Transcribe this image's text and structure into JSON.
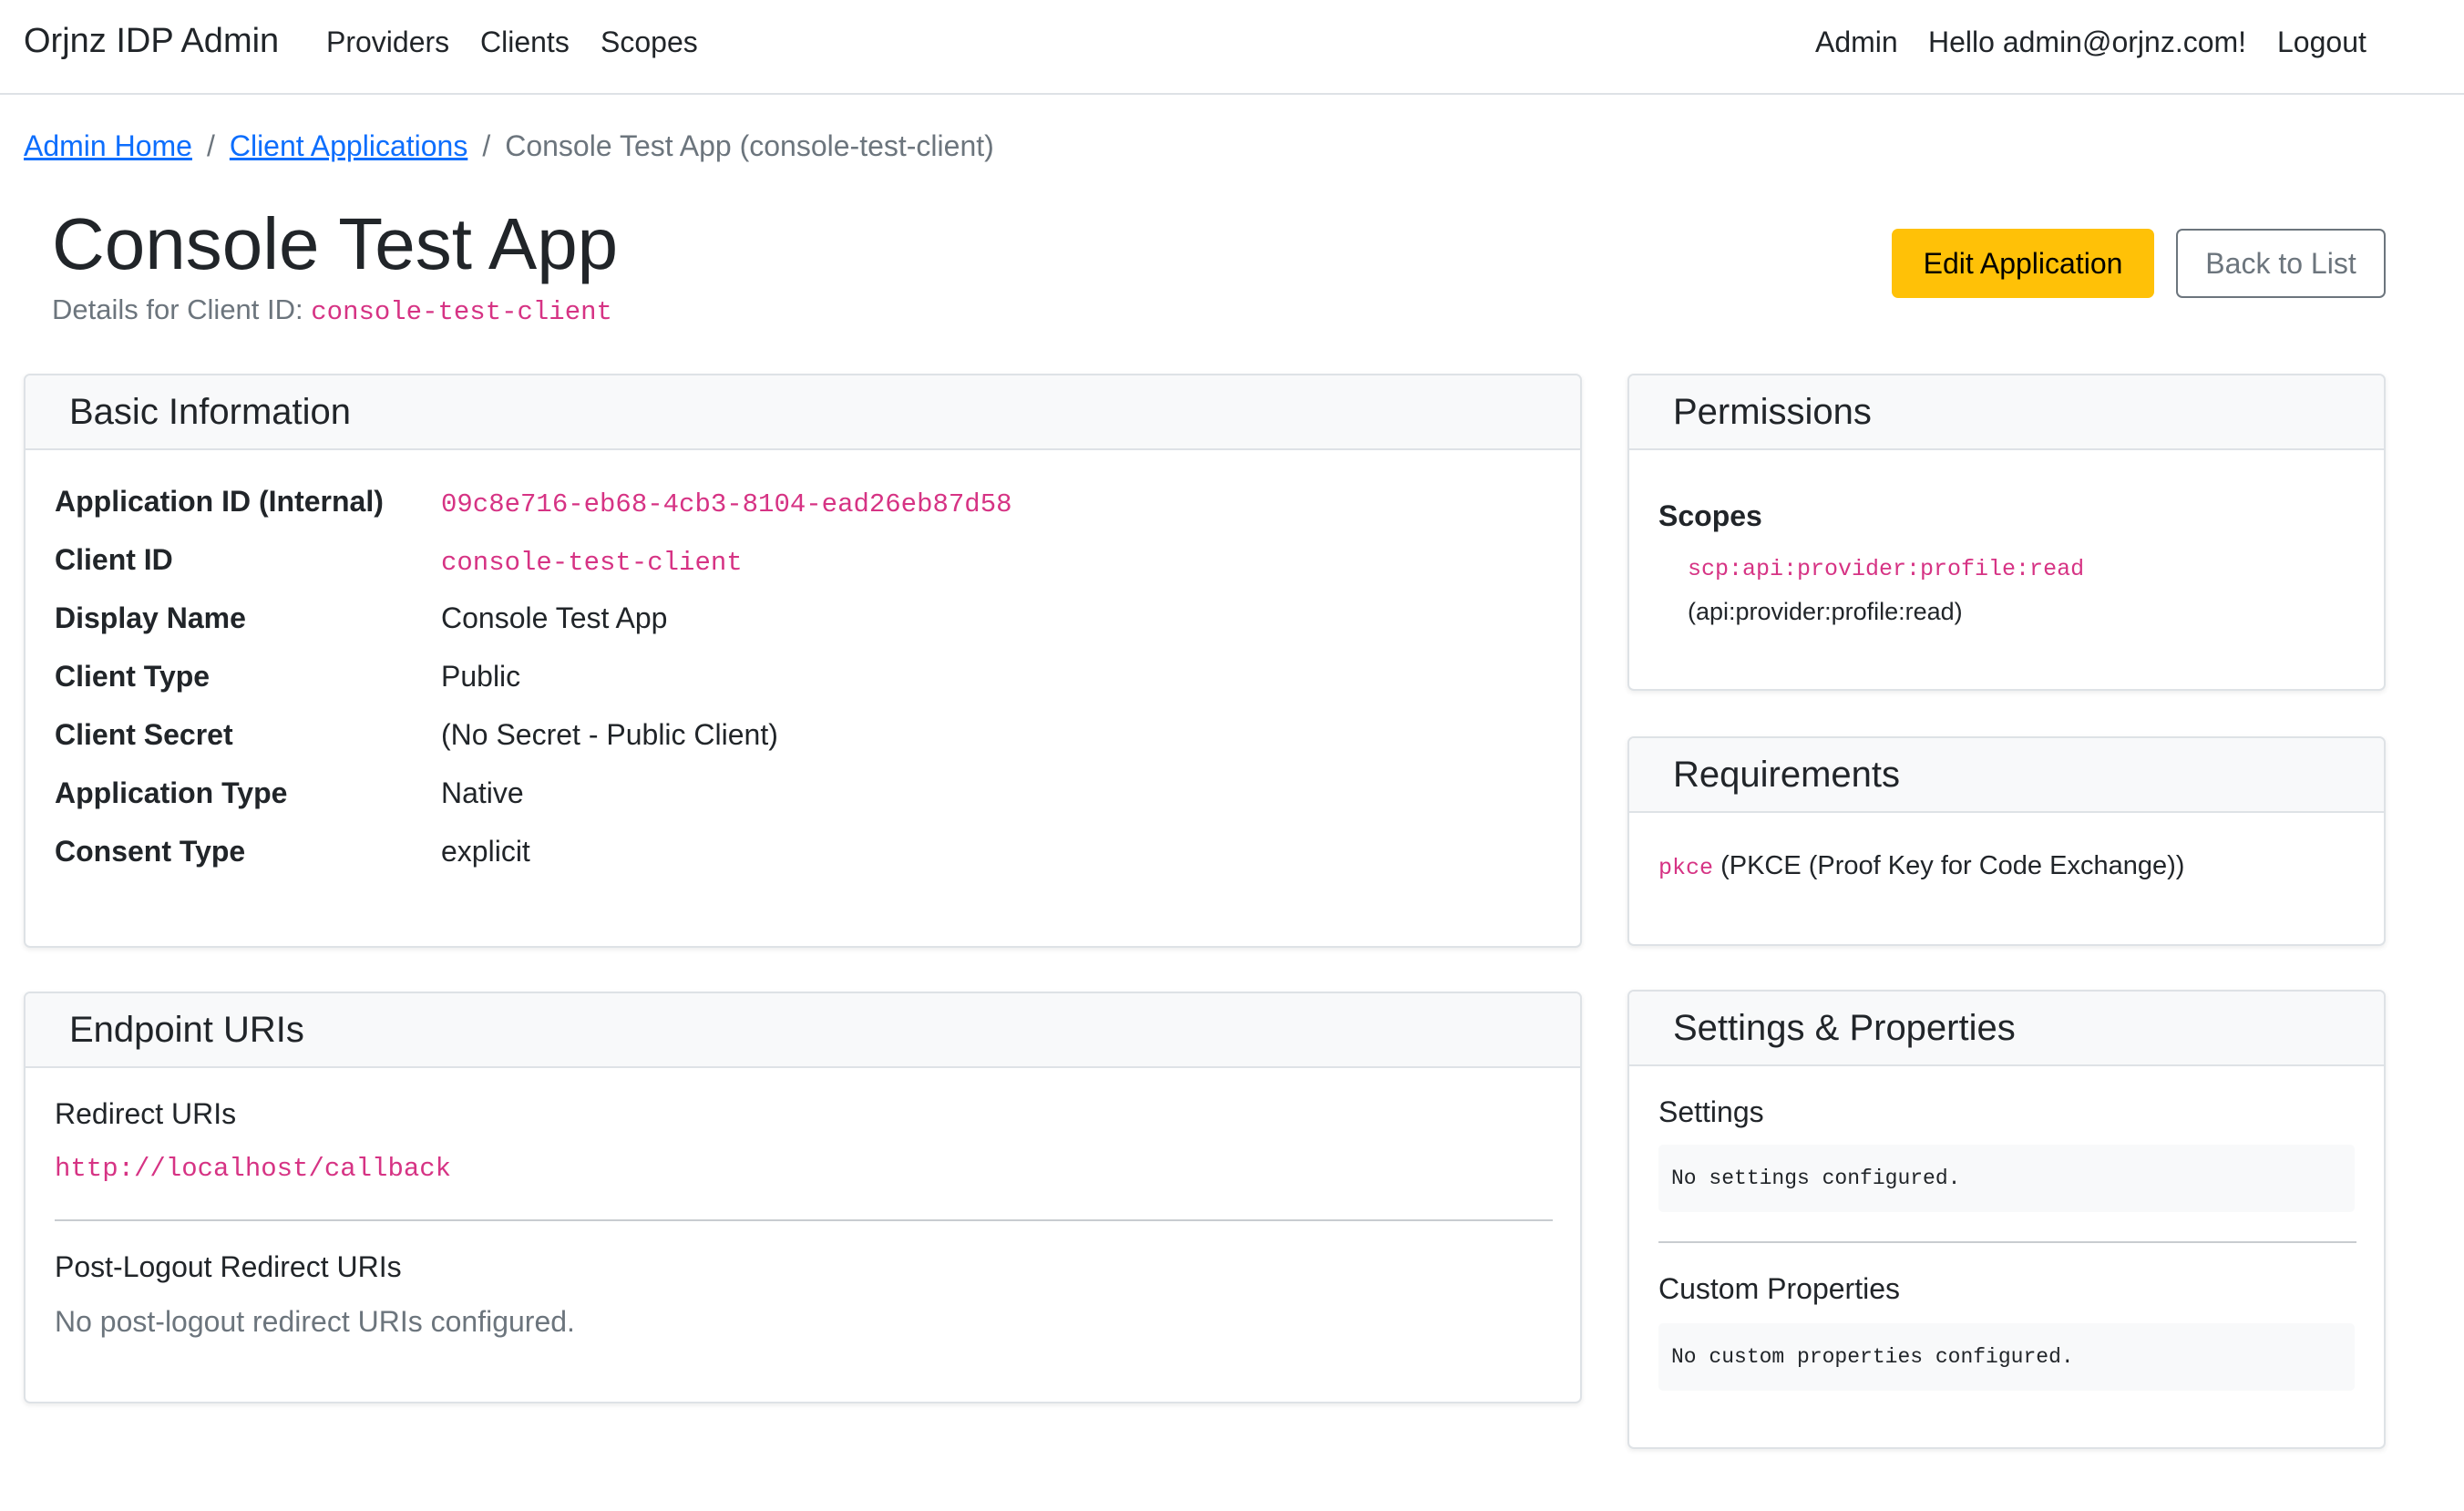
{
  "nav": {
    "brand": "Orjnz IDP Admin",
    "links": [
      "Providers",
      "Clients",
      "Scopes"
    ],
    "admin": "Admin",
    "greeting": "Hello admin@orjnz.com!",
    "logout": "Logout"
  },
  "breadcrumb": {
    "home": "Admin Home",
    "clients": "Client Applications",
    "current": "Console Test App (console-test-client)",
    "separator": "/"
  },
  "header": {
    "title": "Console Test App",
    "subtitle_prefix": "Details for Client ID:",
    "client_id": "console-test-client",
    "edit_button": "Edit Application",
    "back_button": "Back to List"
  },
  "basic_info": {
    "title": "Basic Information",
    "rows": [
      {
        "label": "Application ID (Internal)",
        "value": "09c8e716-eb68-4cb3-8104-ead26eb87d58"
      },
      {
        "label": "Client ID",
        "value": "console-test-client"
      },
      {
        "label": "Display Name",
        "value": "Console Test App"
      },
      {
        "label": "Client Type",
        "value": "Public"
      },
      {
        "label": "Client Secret",
        "value": "(No Secret - Public Client)"
      },
      {
        "label": "Application Type",
        "value": "Native"
      },
      {
        "label": "Consent Type",
        "value": "explicit"
      }
    ]
  },
  "endpoints": {
    "title": "Endpoint URIs",
    "redirect_title": "Redirect URIs",
    "redirect_uri": "http://localhost/callback",
    "post_logout_title": "Post-Logout Redirect URIs",
    "post_logout_empty": "No post-logout redirect URIs configured."
  },
  "permissions": {
    "title": "Permissions",
    "scopes_title": "Scopes",
    "scope_code": "scp:api:provider:profile:read",
    "scope_desc": "(api:provider:profile:read)"
  },
  "requirements": {
    "title": "Requirements",
    "code": "pkce",
    "desc": "(PKCE (Proof Key for Code Exchange))"
  },
  "settings": {
    "title": "Settings & Properties",
    "settings_title": "Settings",
    "settings_empty": "No settings configured.",
    "custom_title": "Custom Properties",
    "custom_empty": "No custom properties configured."
  },
  "colors": {
    "link": "#0d6efd",
    "code": "#d63384",
    "warning": "#ffc107",
    "muted": "#6c757d"
  }
}
